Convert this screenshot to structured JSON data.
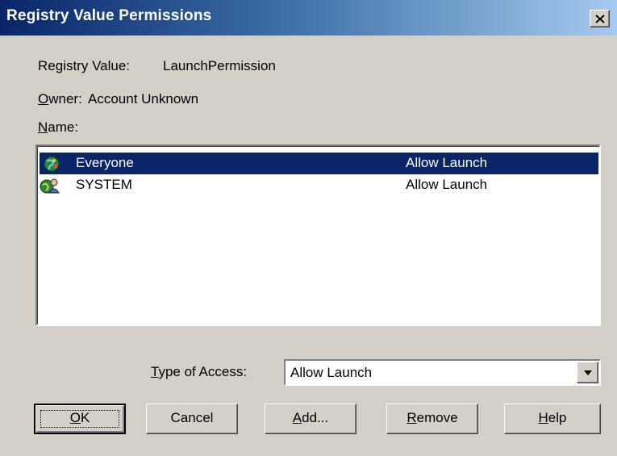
{
  "window": {
    "title": "Registry Value Permissions"
  },
  "info": {
    "registry_value_label": "Registry Value:",
    "registry_value": "LaunchPermission",
    "owner_label": "Owner:",
    "owner_value": "Account Unknown",
    "name_label": "Name:"
  },
  "list": [
    {
      "name": "Everyone",
      "permission": "Allow Launch",
      "icon": "group-globe-icon",
      "selected": true
    },
    {
      "name": "SYSTEM",
      "permission": "Allow Launch",
      "icon": "system-user-icon",
      "selected": false
    }
  ],
  "access": {
    "label": "Type of Access:",
    "value": "Allow Launch"
  },
  "buttons": {
    "ok": "OK",
    "cancel": "Cancel",
    "add": "Add...",
    "remove": "Remove",
    "help": "Help"
  },
  "colors": {
    "titlebar_start": "#0a246a",
    "titlebar_end": "#a6caf0",
    "face": "#d4d0c8",
    "selection": "#0a246a"
  }
}
